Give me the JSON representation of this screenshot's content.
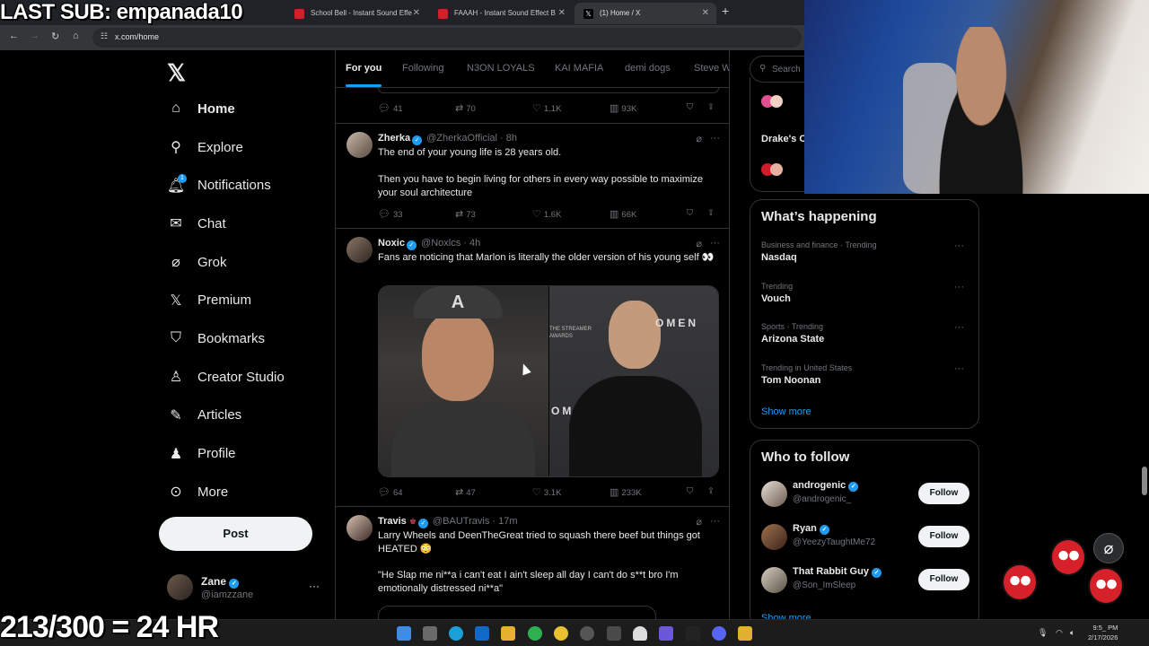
{
  "overlay": {
    "last_sub": "LAST SUB: empanada10",
    "counter": "213/300 = 24 HR"
  },
  "browser": {
    "tabs": [
      {
        "title": "School Bell - Instant Sound Effe",
        "fav_color": "#d0202a"
      },
      {
        "title": "FAAAH - Instant Sound Effect B",
        "fav_color": "#d0202a"
      },
      {
        "title": "(1) Home / X",
        "fav_color": "#000000"
      }
    ],
    "url": "x.com/home"
  },
  "nav": {
    "items": [
      {
        "label": "Home",
        "icon": "house-icon"
      },
      {
        "label": "Explore",
        "icon": "search-icon"
      },
      {
        "label": "Notifications",
        "icon": "bell-icon",
        "badge": "1"
      },
      {
        "label": "Chat",
        "icon": "mail-icon"
      },
      {
        "label": "Grok",
        "icon": "grok-icon"
      },
      {
        "label": "Premium",
        "icon": "x-logo-icon"
      },
      {
        "label": "Bookmarks",
        "icon": "bookmark-icon"
      },
      {
        "label": "Creator Studio",
        "icon": "creator-icon"
      },
      {
        "label": "Articles",
        "icon": "article-icon"
      },
      {
        "label": "Profile",
        "icon": "person-icon"
      },
      {
        "label": "More",
        "icon": "more-circle-icon"
      }
    ],
    "post_label": "Post",
    "me": {
      "name": "Zane",
      "handle": "@iamzzane"
    }
  },
  "feed": {
    "tabs": [
      "For you",
      "Following",
      "N3ON LOYALS",
      "KAI MAFIA",
      "demi dogs",
      "Steve W"
    ],
    "first_actions": {
      "replies": "41",
      "reposts": "70",
      "likes": "1.1K",
      "views": "93K"
    },
    "tweets": [
      {
        "name": "Zherka",
        "handle": "@ZherkaOfficial",
        "time": "· 8h",
        "text1": "The end of your young life is 28 years old.",
        "text2": "Then you have to begin living for others in every way possible to maximize your soul architecture",
        "replies": "33",
        "reposts": "73",
        "likes": "1.6K",
        "views": "66K"
      },
      {
        "name": "Noxic",
        "handle": "@Noxlcs",
        "time": "· 4h",
        "text1": "Fans are noticing that Marlon is literally the older version of his young self 👀",
        "media_left_text": "A",
        "media_right_text1": "OMEN",
        "media_right_text2": "OM",
        "media_right_text3": "THE STREAMER AWARDS",
        "replies": "64",
        "reposts": "47",
        "likes": "3.1K",
        "views": "233K"
      },
      {
        "name": "Travis",
        "handle": "@BAUTravis",
        "time": "· 17m",
        "text1": "Larry Wheels and DeenTheGreat tried to squash there beef but things got HEATED 😳",
        "text2": "\"He Slap me ni**a i can't eat I ain't sleep all day I can't do s**t bro I'm emotionally distressed ni**a\""
      }
    ]
  },
  "right": {
    "search_placeholder": "Search",
    "live_item": "Drake's C Canada fo",
    "whats_happening": {
      "title": "What’s happening",
      "trends": [
        {
          "context": "Business and finance · Trending",
          "topic": "Nasdaq"
        },
        {
          "context": "Trending",
          "topic": "Vouch"
        },
        {
          "context": "Sports · Trending",
          "topic": "Arizona State"
        },
        {
          "context": "Trending in United States",
          "topic": "Tom Noonan"
        }
      ],
      "show_more": "Show more"
    },
    "who_to_follow": {
      "title": "Who to follow",
      "accounts": [
        {
          "name": "androgenic",
          "handle": "@androgenic_",
          "verified": true
        },
        {
          "name": "Ryan",
          "handle": "@YeezyTaughtMe72",
          "verified": true
        },
        {
          "name": "That Rabbit Guy",
          "handle": "@Son_ImSleep",
          "verified": true
        }
      ],
      "follow_label": "Follow",
      "show_more": "Show more"
    }
  },
  "taskbar": {
    "time": "9:5_ PM",
    "date": "2/17/2026"
  }
}
